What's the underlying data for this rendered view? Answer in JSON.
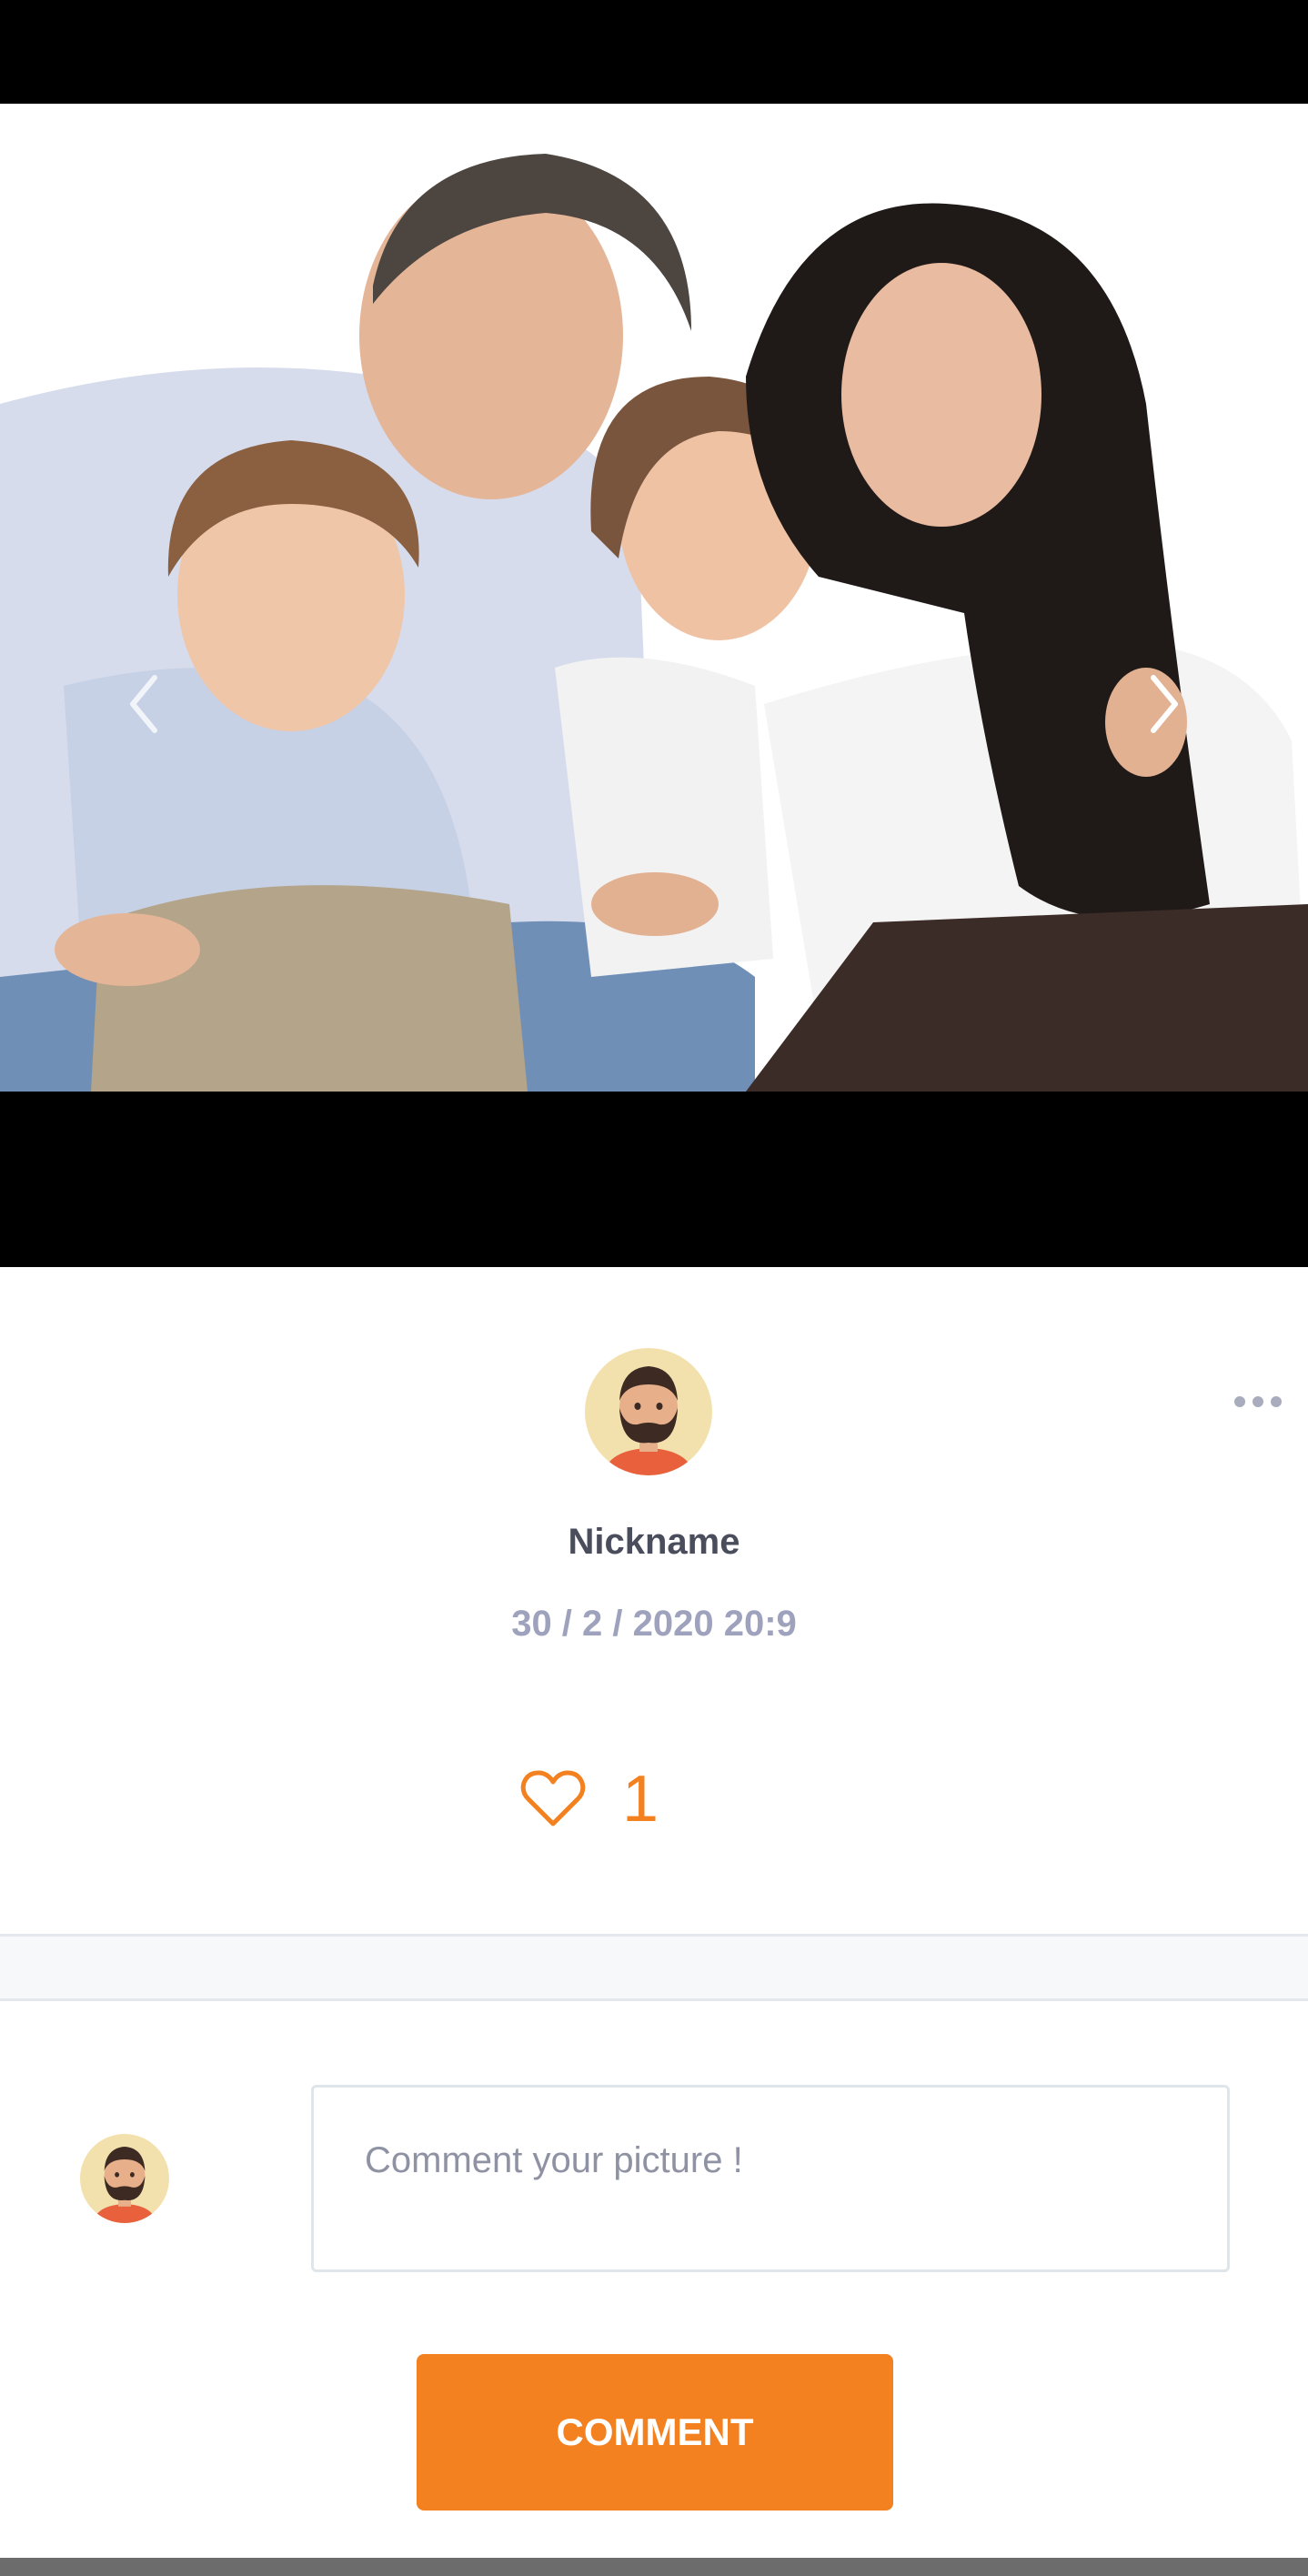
{
  "post": {
    "image_alt": "Family photo",
    "author": {
      "nickname": "Nickname"
    },
    "date": "30 / 2 / 2020 20:9",
    "likes": "1"
  },
  "comment": {
    "placeholder": "Comment your picture !",
    "submit_label": "COMMENT"
  },
  "icons": {
    "prev": "chevron-left-icon",
    "next": "chevron-right-icon",
    "more": "more-dots-icon",
    "like": "heart-outline-icon"
  },
  "colors": {
    "accent": "#f48120",
    "nickname": "#4a4d5c",
    "date": "#9ea2bd",
    "divider": "#f7f8fa"
  }
}
